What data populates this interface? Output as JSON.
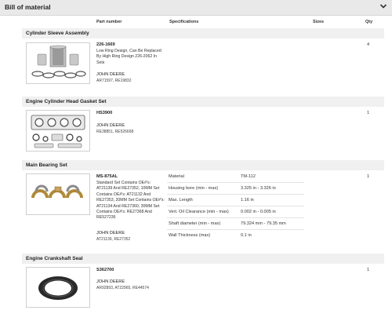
{
  "header": {
    "title": "Bill of material"
  },
  "columns": {
    "part_number": "Part number",
    "specifications": "Specifications",
    "sizes": "Sizes",
    "qty": "Qty"
  },
  "items": [
    {
      "section": "Cylinder Sleeve Assembly",
      "part_number": "226-1669",
      "description": [
        "Low Ring Design, Can Be Replaced",
        "By High Ring Design 226-2062 In",
        "Sets"
      ],
      "brand": "JOHN DEERE",
      "refs": "AR71597, RE19832",
      "qty": "4"
    },
    {
      "section": "Engine Cylinder Head Gasket Set",
      "part_number": "HS3900",
      "brand": "JOHN DEERE",
      "refs": "RE38851, RE526668",
      "qty": "1"
    },
    {
      "section": "Main Bearing Set",
      "part_number": "MS-875AL",
      "description": [
        "Standard Set Contains OE#'s:",
        "AT21139 And RE27352, 10MM Set",
        "Contains OE#'s: AT21132 And",
        "RE27353, 20MM Set Contains OE#'s:",
        "AT21134 And RE27360, 30MM Set",
        "Contains OE#'s: RE27368 And",
        "RE527236"
      ],
      "brand": "JOHN DEERE",
      "refs": "AT21139, RE27352",
      "qty": "1",
      "specs": [
        {
          "name": "Material",
          "value": "TM-112"
        },
        {
          "name": "Housing bore (min - max)",
          "value": "3.325 in - 3.326 in"
        },
        {
          "name": "Max. Length",
          "value": "1.16 in"
        },
        {
          "name": "Vert. Oil Clearance (min - max)",
          "value": "0.002 in - 0.005 in"
        },
        {
          "name": "Shaft diameter (min - max)",
          "value": "79.324 mm - 79.35 mm"
        },
        {
          "name": "Wall Thickness (max)",
          "value": "0.1 in"
        }
      ]
    },
    {
      "section": "Engine Crankshaft Seal",
      "part_number": "S362700",
      "brand": "JOHN DEERE",
      "refs": "AR92893, AT22965, RE44574",
      "qty": "1"
    }
  ]
}
